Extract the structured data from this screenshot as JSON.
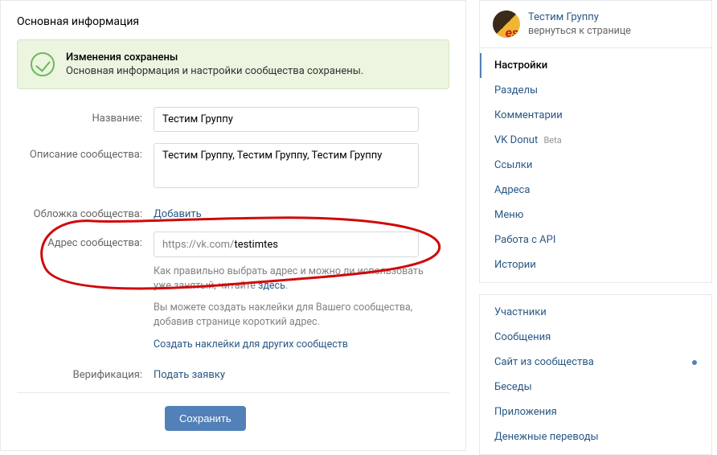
{
  "header": {
    "title": "Основная информация"
  },
  "banner": {
    "title": "Изменения сохранены",
    "subtitle": "Основная информация и настройки сообщества сохранены."
  },
  "form": {
    "name_label": "Название:",
    "name_value": "Тестим Группу",
    "desc_label": "Описание сообщества:",
    "desc_value": "Тестим Группу, Тестим Группу, Тестим Группу",
    "cover_label": "Обложка сообщества:",
    "cover_action": "Добавить",
    "addr_label": "Адрес сообщества:",
    "addr_prefix": "https://vk.com/",
    "addr_value": "testimtes",
    "addr_hint_1a": "Как правильно выбрать адрес и можно ли использовать уже занятый, читайте ",
    "addr_hint_1b": "здесь",
    "addr_hint_1c": ".",
    "addr_hint_2": "Вы можете создать наклейки для Вашего сообщества, добавив странице короткий адрес.",
    "addr_hint_3": "Создать наклейки для других сообществ",
    "verif_label": "Верификация:",
    "verif_action": "Подать заявку",
    "save_label": "Сохранить"
  },
  "group": {
    "name": "Тестим Группу",
    "back": "вернуться к странице"
  },
  "nav1": [
    {
      "label": "Настройки",
      "active": true
    },
    {
      "label": "Разделы"
    },
    {
      "label": "Комментарии"
    },
    {
      "label": "VK Donut",
      "beta": "Beta"
    },
    {
      "label": "Ссылки"
    },
    {
      "label": "Адреса"
    },
    {
      "label": "Меню"
    },
    {
      "label": "Работа с API"
    },
    {
      "label": "Истории"
    }
  ],
  "nav2": [
    {
      "label": "Участники"
    },
    {
      "label": "Сообщения"
    },
    {
      "label": "Сайт из сообщества",
      "dot": true
    },
    {
      "label": "Беседы"
    },
    {
      "label": "Приложения"
    },
    {
      "label": "Денежные переводы"
    }
  ]
}
